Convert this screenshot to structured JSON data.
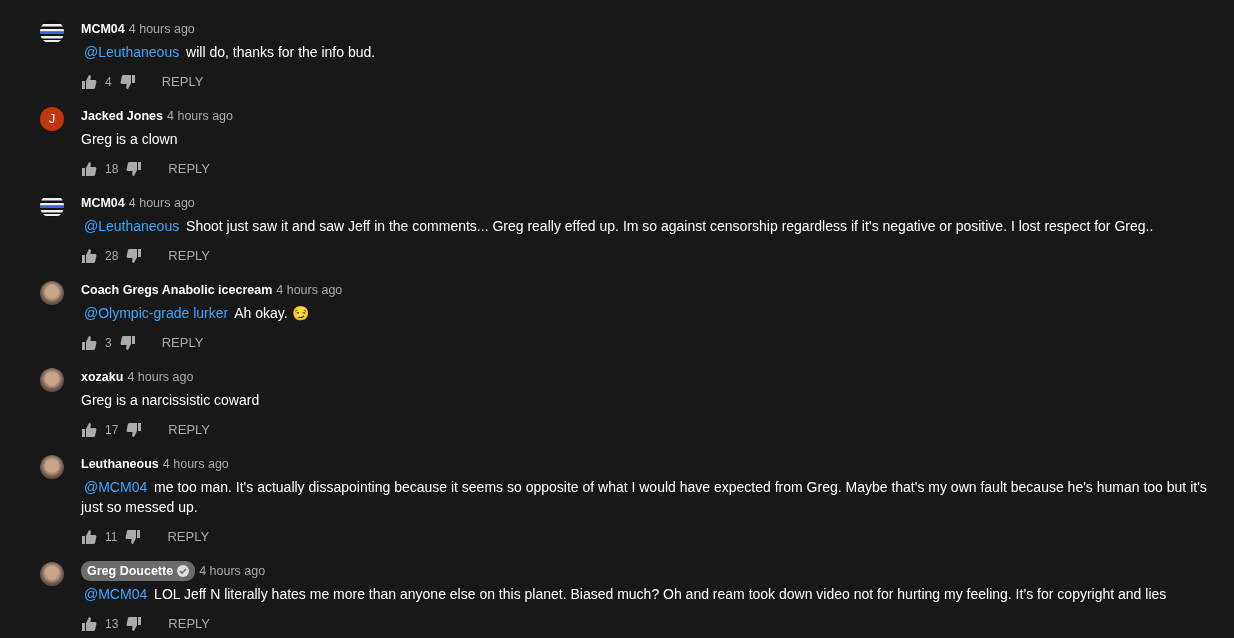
{
  "comments": [
    {
      "author": "MCM04",
      "time": "4 hours ago",
      "avatar": {
        "kind": "flag"
      },
      "owner": false,
      "mention": "@Leuthaneous",
      "text": "will do, thanks for the info bud.",
      "likes": "4",
      "reply": "REPLY"
    },
    {
      "author": "Jacked Jones",
      "time": "4 hours ago",
      "avatar": {
        "kind": "letter",
        "letter": "J",
        "color": "#c2360f"
      },
      "owner": false,
      "text": "Greg is a clown",
      "likes": "18",
      "reply": "REPLY"
    },
    {
      "author": "MCM04",
      "time": "4 hours ago",
      "avatar": {
        "kind": "flag"
      },
      "owner": false,
      "mention": "@Leuthaneous",
      "text": "Shoot just saw it and saw Jeff in the comments... Greg really effed up. Im so against censorship regardless if it’s negative or positive. I lost respect for Greg..",
      "likes": "28",
      "reply": "REPLY"
    },
    {
      "author": "Coach Gregs Anabolic icecream",
      "time": "4 hours ago",
      "avatar": {
        "kind": "photo"
      },
      "owner": false,
      "mention": "@Olympic-grade lurker",
      "text": "Ah okay. 😏",
      "likes": "3",
      "reply": "REPLY"
    },
    {
      "author": "xozaku",
      "time": "4 hours ago",
      "avatar": {
        "kind": "photo"
      },
      "owner": false,
      "text": "Greg is a narcissistic coward",
      "likes": "17",
      "reply": "REPLY"
    },
    {
      "author": "Leuthaneous",
      "time": "4 hours ago",
      "avatar": {
        "kind": "photo"
      },
      "owner": false,
      "mention": "@MCM04",
      "text": "me too man. It's actually dissapointing because it seems so opposite of what I would have expected from Greg. Maybe that's my own fault because he's human too but it's just so messed up.",
      "likes": "11",
      "reply": "REPLY"
    },
    {
      "author": "Greg Doucette",
      "time": "4 hours ago",
      "avatar": {
        "kind": "photo"
      },
      "owner": true,
      "mention": "@MCM04",
      "text": "LOL Jeff N literally hates me more than anyone else on this planet. Biased much? Oh and ream took down video not for hurting my feeling. It’s for copyright and lies",
      "likes": "13",
      "reply": "REPLY"
    }
  ]
}
